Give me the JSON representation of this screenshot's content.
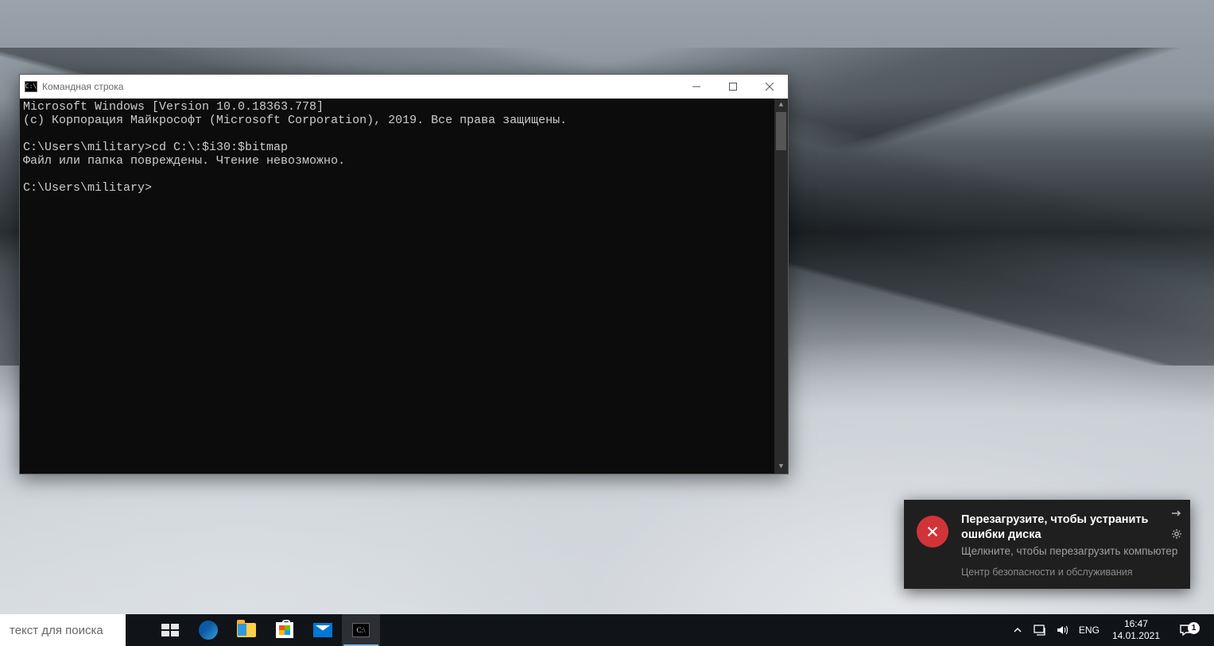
{
  "cmd": {
    "title": "Командная строка",
    "icon_text": "C:\\",
    "lines": {
      "l1": "Microsoft Windows [Version 10.0.18363.778]",
      "l2": "(c) Корпорация Майкрософт (Microsoft Corporation), 2019. Все права защищены.",
      "blank1": "",
      "prompt1": "C:\\Users\\military>cd C:\\:$i30:$bitmap",
      "err": "Файл или папка повреждены. Чтение невозможно.",
      "blank2": "",
      "prompt2": "C:\\Users\\military>"
    }
  },
  "toast": {
    "title": "Перезагрузите, чтобы устранить ошибки диска",
    "body": "Щелкните, чтобы перезагрузить компьютер",
    "source": "Центр безопасности и обслуживания"
  },
  "taskbar": {
    "search_placeholder": "текст для поиска",
    "lang": "ENG",
    "time": "16:47",
    "date": "14.01.2021",
    "notif_count": "1"
  }
}
